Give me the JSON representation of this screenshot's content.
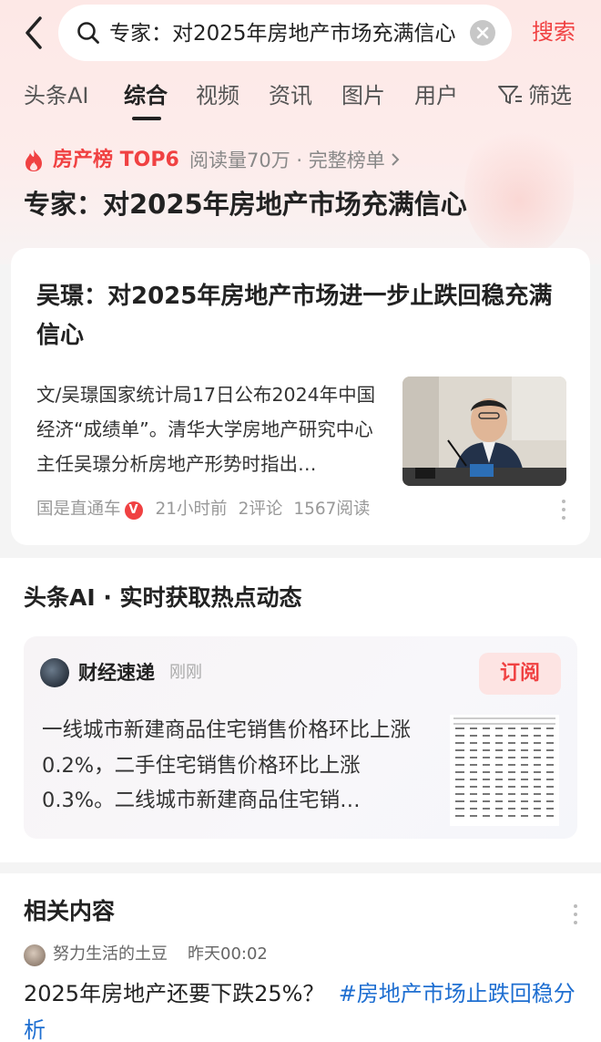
{
  "search": {
    "query": "专家：对2025年房地产市场充满信心",
    "action_label": "搜索"
  },
  "tabs": [
    {
      "label": "头条AI"
    },
    {
      "label": "综合"
    },
    {
      "label": "视频"
    },
    {
      "label": "资讯"
    },
    {
      "label": "图片"
    },
    {
      "label": "用户"
    }
  ],
  "filter_label": "筛选",
  "hot": {
    "board": "房产榜 TOP6",
    "meta": "阅读量70万 · 完整榜单",
    "headline": "专家：对2025年房地产市场充满信心"
  },
  "article": {
    "title": "吴璟：对2025年房地产市场进一步止跌回稳充满信心",
    "summary": "文/吴璟国家统计局17日公布2024年中国经济“成绩单”。清华大学房地产研究中心主任吴璟分析房地产形势时指出…",
    "source": "国是直通车",
    "verified_badge": "V",
    "time": "21小时前",
    "comments": "2评论",
    "reads": "1567阅读",
    "thumbnail_icon": "speaker-photo"
  },
  "ai_section": {
    "heading": "头条AI · 实时获取热点动态",
    "source": "财经速递",
    "time": "刚刚",
    "subscribe_label": "订阅",
    "summary": "一线城市新建商品住宅销售价格环比上涨0.2%，二手住宅销售价格环比上涨0.3%。二线城市新建商品住宅销…",
    "thumbnail_icon": "data-table-image"
  },
  "related": {
    "heading": "相关内容",
    "author": "努力生活的土豆",
    "time": "昨天00:02",
    "title": "2025年房地产还要下跌25%？",
    "hashtag": "#房地产市场止跌回稳分析"
  },
  "colors": {
    "accent": "#f04142",
    "hashtag": "#1f6fd1"
  }
}
